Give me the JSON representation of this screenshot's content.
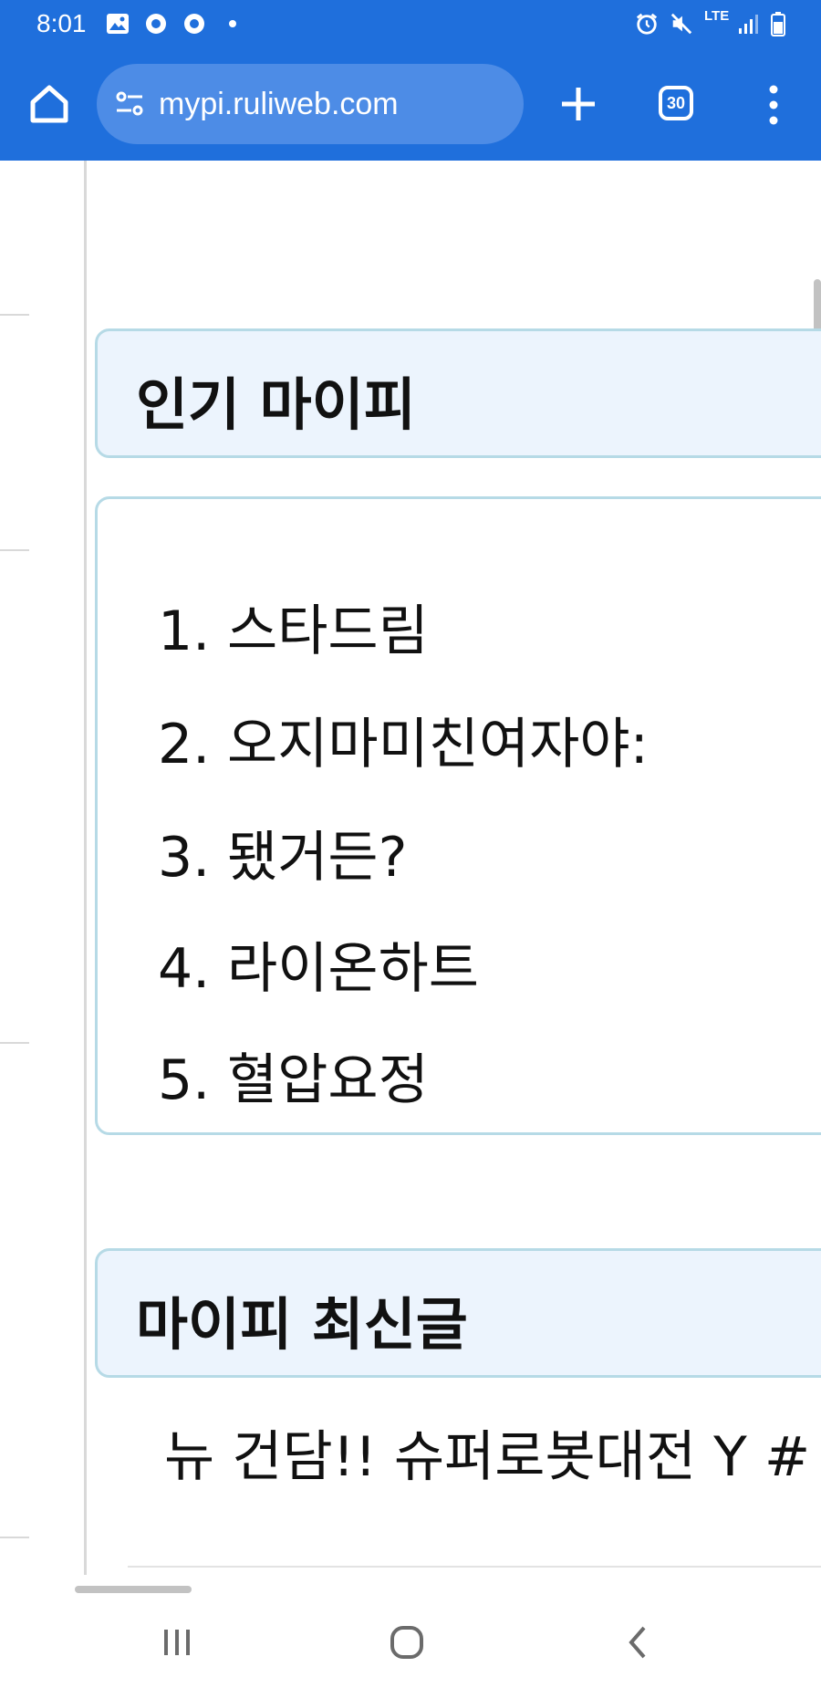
{
  "status_bar": {
    "time": "8:01",
    "network": "LTE",
    "icons": [
      "gallery-icon",
      "chrome-icon",
      "chrome-icon",
      "dot-icon",
      "alarm-icon",
      "mute-icon",
      "signal-icon",
      "battery-icon"
    ]
  },
  "browser": {
    "url": "mypi.ruliweb.com",
    "tab_count": "30",
    "accent_color": "#1f6fdc"
  },
  "popular": {
    "title": "인기 마이피",
    "items": [
      {
        "num": "1.",
        "name": "스타드림"
      },
      {
        "num": "2.",
        "name": "오지마미친여자야:"
      },
      {
        "num": "3.",
        "name": "됐거든?"
      },
      {
        "num": "4.",
        "name": "라이온하트"
      },
      {
        "num": "5.",
        "name": "혈압요정"
      }
    ]
  },
  "latest": {
    "title": "마이피 최신글",
    "first_post": "뉴 건담!! 슈퍼로봇대전 Y #"
  },
  "nav": {
    "buttons": [
      "recent-apps-icon",
      "home-circle-icon",
      "back-icon"
    ]
  }
}
